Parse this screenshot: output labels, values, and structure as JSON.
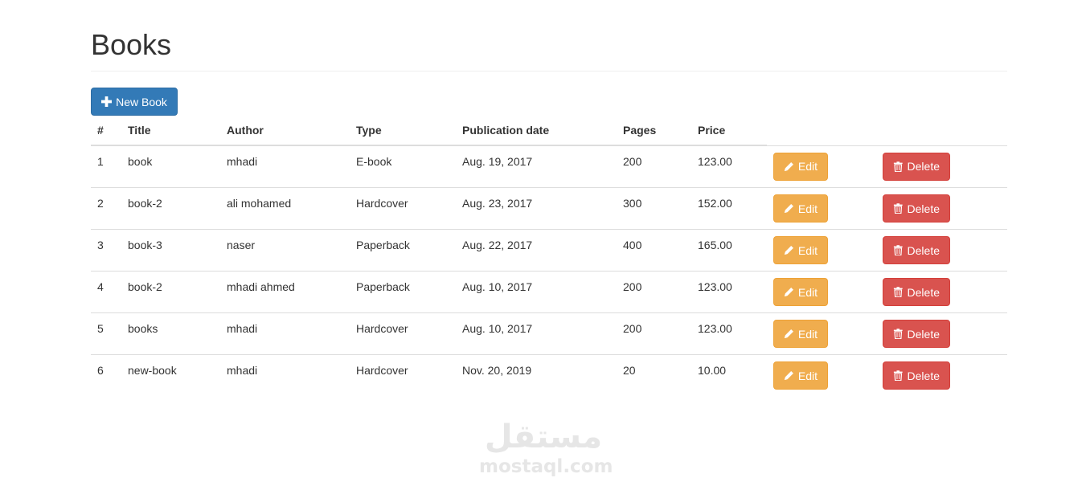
{
  "page": {
    "title": "Books"
  },
  "toolbar": {
    "new_label": "New Book"
  },
  "table": {
    "headers": {
      "num": "#",
      "title": "Title",
      "author": "Author",
      "type": "Type",
      "pubdate": "Publication date",
      "pages": "Pages",
      "price": "Price"
    },
    "edit_label": "Edit",
    "delete_label": "Delete",
    "rows": [
      {
        "num": "1",
        "title": "book",
        "author": "mhadi",
        "type": "E-book",
        "pubdate": "Aug. 19, 2017",
        "pages": "200",
        "price": "123.00"
      },
      {
        "num": "2",
        "title": "book-2",
        "author": "ali mohamed",
        "type": "Hardcover",
        "pubdate": "Aug. 23, 2017",
        "pages": "300",
        "price": "152.00"
      },
      {
        "num": "3",
        "title": "book-3",
        "author": "naser",
        "type": "Paperback",
        "pubdate": "Aug. 22, 2017",
        "pages": "400",
        "price": "165.00"
      },
      {
        "num": "4",
        "title": "book-2",
        "author": "mhadi ahmed",
        "type": "Paperback",
        "pubdate": "Aug. 10, 2017",
        "pages": "200",
        "price": "123.00"
      },
      {
        "num": "5",
        "title": "books",
        "author": "mhadi",
        "type": "Hardcover",
        "pubdate": "Aug. 10, 2017",
        "pages": "200",
        "price": "123.00"
      },
      {
        "num": "6",
        "title": "new-book",
        "author": "mhadi",
        "type": "Hardcover",
        "pubdate": "Nov. 20, 2019",
        "pages": "20",
        "price": "10.00"
      }
    ]
  },
  "watermark": {
    "arabic": "مستقل",
    "latin": "mostaql.com"
  },
  "icons": {
    "new": "plus-icon",
    "edit": "pencil-icon",
    "delete": "trash-icon"
  },
  "colors": {
    "primary": "#337ab7",
    "warning": "#f0ad4e",
    "danger": "#d9534f",
    "text": "#333333"
  }
}
